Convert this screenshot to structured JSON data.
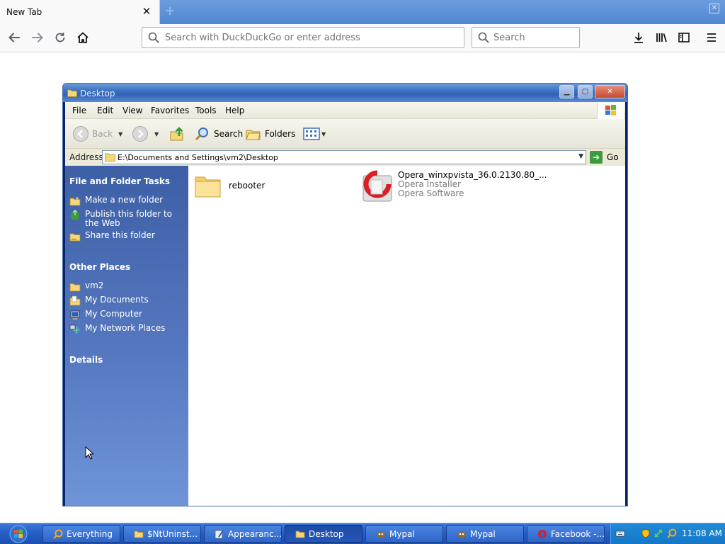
{
  "browser": {
    "tab_title": "New Tab",
    "address_placeholder": "Search with DuckDuckGo or enter address",
    "search_placeholder": "Search"
  },
  "explorer": {
    "title": "Desktop",
    "menu": [
      "File",
      "Edit",
      "View",
      "Favorites",
      "Tools",
      "Help"
    ],
    "toolbar": {
      "back": "Back",
      "search": "Search",
      "folders": "Folders"
    },
    "address": {
      "label": "Address",
      "path": "E:\\Documents and Settings\\vm2\\Desktop",
      "go": "Go"
    },
    "task_pane": {
      "file_tasks_heading": "File and Folder Tasks",
      "file_tasks": [
        "Make a new folder",
        "Publish this folder to the Web",
        "Share this folder"
      ],
      "other_places_heading": "Other Places",
      "other_places": [
        "vm2",
        "My Documents",
        "My Computer",
        "My Network Places"
      ],
      "details_heading": "Details"
    },
    "items": [
      {
        "name": "rebooter",
        "type": "folder"
      },
      {
        "name": "Opera_winxpvista_36.0.2130.80_...",
        "line2": "Opera Installer",
        "line3": "Opera Software",
        "type": "installer"
      }
    ]
  },
  "taskbar": {
    "buttons": [
      {
        "label": "Everything",
        "icon": "search-icon"
      },
      {
        "label": "$NtUninst...",
        "icon": "folder-icon"
      },
      {
        "label": "Appearanc...",
        "icon": "appearance-icon"
      },
      {
        "label": "Desktop",
        "icon": "folder-icon",
        "active": true
      },
      {
        "label": "Mypal",
        "icon": "mypal-icon"
      },
      {
        "label": "Mypal",
        "icon": "mypal-icon"
      },
      {
        "label": "Facebook -...",
        "icon": "opera-icon"
      }
    ],
    "clock": "11:08 AM"
  },
  "colors": {
    "tabstrip": "#4f86d0",
    "taskpane": "#5578c0",
    "taskbar": "#245dc4",
    "tray": "#1577c8"
  }
}
